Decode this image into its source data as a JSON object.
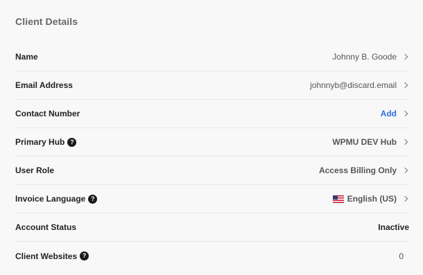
{
  "section": {
    "title": "Client Details"
  },
  "rows": {
    "name": {
      "label": "Name",
      "value": "Johnny B. Goode"
    },
    "email": {
      "label": "Email Address",
      "value": "johnnyb@discard.email"
    },
    "contact": {
      "label": "Contact Number",
      "value": "Add"
    },
    "hub": {
      "label": "Primary Hub",
      "value": "WPMU DEV Hub"
    },
    "role": {
      "label": "User Role",
      "value": "Access Billing Only"
    },
    "language": {
      "label": "Invoice Language",
      "value": "English (US)"
    },
    "status": {
      "label": "Account Status",
      "value": "Inactive"
    },
    "websites": {
      "label": "Client Websites",
      "value": "0"
    }
  },
  "icons": {
    "help": "question-circle-icon",
    "chevron": "chevron-right-icon",
    "flag": "us-flag-icon"
  },
  "colors": {
    "link": "#2b6ee1",
    "background": "#f8f8f8",
    "divider": "#e6e6e6"
  }
}
